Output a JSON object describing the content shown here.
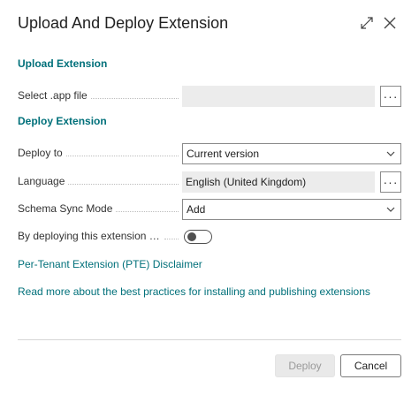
{
  "dialog": {
    "title": "Upload And Deploy Extension",
    "expand_icon": "expand-arrows-icon",
    "close_icon": "close-icon"
  },
  "upload_section": {
    "heading": "Upload Extension",
    "select_file": {
      "label": "Select .app file",
      "value": "",
      "lookup_label": "···"
    }
  },
  "deploy_section": {
    "heading": "Deploy Extension",
    "deploy_to": {
      "label": "Deploy to",
      "value": "Current version"
    },
    "language": {
      "label": "Language",
      "value": "English (United Kingdom)",
      "lookup_label": "···"
    },
    "schema_sync_mode": {
      "label": "Schema Sync Mode",
      "value": "Add"
    },
    "consent": {
      "label": "By deploying this extension yo...",
      "checked": false
    }
  },
  "links": {
    "disclaimer": "Per-Tenant Extension (PTE) Disclaimer",
    "best_practices": "Read more about the best practices for installing and publishing extensions"
  },
  "footer": {
    "deploy_label": "Deploy",
    "cancel_label": "Cancel"
  },
  "colors": {
    "accent": "#00707a",
    "disabled_button": "#e9e9e9"
  }
}
